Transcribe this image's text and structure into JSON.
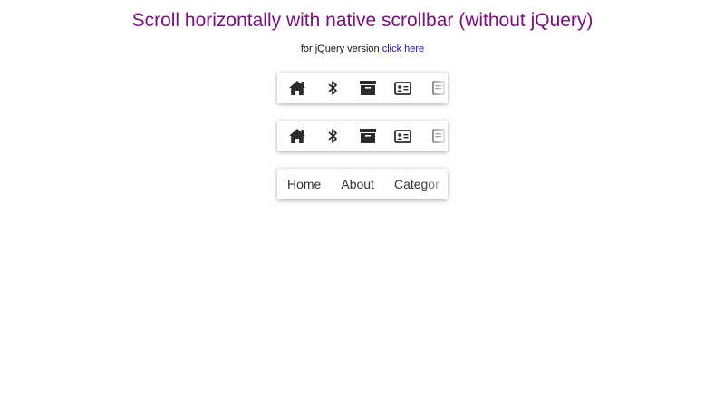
{
  "header": {
    "title": "Scroll horizontally with native scrollbar (without jQuery)",
    "subtitle_prefix": "for jQuery version",
    "subtitle_link": "click here"
  },
  "icon_scroller_1": {
    "icons": [
      "home-icon",
      "bluetooth-icon",
      "archive-icon",
      "id-card-icon",
      "file-icon"
    ]
  },
  "icon_scroller_2": {
    "icons": [
      "home-icon",
      "bluetooth-icon",
      "archive-icon",
      "id-card-icon",
      "file-icon"
    ]
  },
  "text_scroller": {
    "items": [
      "Home",
      "About",
      "Categor"
    ]
  },
  "colors": {
    "title": "#7a0f7e",
    "link": "#1a0dab",
    "icon": "#2b2b2b"
  }
}
